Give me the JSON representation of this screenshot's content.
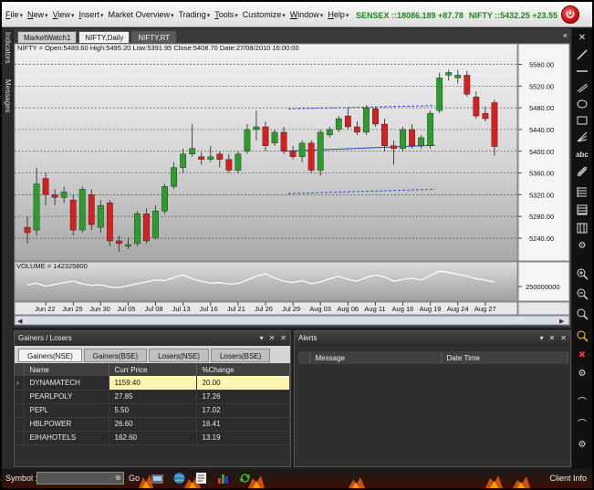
{
  "menu": [
    {
      "label": "File",
      "ul": "F",
      "rest": "ile",
      "caret": true
    },
    {
      "label": "New",
      "ul": "N",
      "rest": "ew",
      "caret": true
    },
    {
      "label": "View",
      "ul": "V",
      "rest": "iew",
      "caret": true
    },
    {
      "label": "Insert",
      "ul": "I",
      "rest": "nsert",
      "caret": true
    },
    {
      "label": "Market Overview",
      "ul": "",
      "rest": "Market Overview",
      "caret": true
    },
    {
      "label": "Trading",
      "ul": "",
      "rest": "Trading",
      "caret": true
    },
    {
      "label": "Tools",
      "ul": "T",
      "rest": "ools",
      "caret": true
    },
    {
      "label": "Customize",
      "ul": "",
      "rest": "Customize",
      "caret": true
    },
    {
      "label": "Window",
      "ul": "W",
      "rest": "indow",
      "caret": true
    },
    {
      "label": "Help",
      "ul": "H",
      "rest": "elp",
      "caret": true
    }
  ],
  "tickers": {
    "sensex": "SENSEX ::18086.189 +87.78",
    "nifty": "NIFTY ::5432.25 +23.55"
  },
  "left_tabs": [
    "Indicators",
    "Messages"
  ],
  "chart_tabs": [
    {
      "label": "MarketWatch1",
      "state": "normal"
    },
    {
      "label": "NIFTY,Daily",
      "state": "active"
    },
    {
      "label": "NIFTY,RT",
      "state": "dark"
    }
  ],
  "chart_close": "×",
  "chart_data": {
    "type": "candlestick",
    "header": "NIFTY = Open:5489.60 High:5495.20 Low:5391.95 Close:5408.70 Date:27/08/2010 16:00:00",
    "volume_label": "VOLUME = 142325800",
    "volume_tick": "250000000",
    "y_ticks": [
      5560.0,
      5520.0,
      5480.0,
      5440.0,
      5400.0,
      5360.0,
      5320.0,
      5280.0,
      5240.0
    ],
    "y_tick_labels": [
      "5560.00",
      "5520.00",
      "5480.00",
      "5440.00",
      "5400.00",
      "5360.00",
      "5320.00",
      "5280.00",
      "5240.00"
    ],
    "ylim": [
      5203,
      5576
    ],
    "x_labels": [
      "Jun 22",
      "Jun 25",
      "Jun 30",
      "Jul 05",
      "Jul 08",
      "Jul 13",
      "Jul 16",
      "Jul 21",
      "Jul 26",
      "Jul 29",
      "Aug 03",
      "Aug 06",
      "Aug 11",
      "Aug 16",
      "Aug 19",
      "Aug 24",
      "Aug 27"
    ],
    "x_label_index": [
      2,
      5,
      8,
      11,
      14,
      17,
      20,
      23,
      26,
      29,
      32,
      35,
      38,
      41,
      44,
      47,
      50
    ],
    "candles": [
      {
        "o": 5260,
        "h": 5280,
        "l": 5230,
        "c": 5250
      },
      {
        "o": 5255,
        "h": 5370,
        "l": 5245,
        "c": 5340
      },
      {
        "o": 5350,
        "h": 5360,
        "l": 5300,
        "c": 5320
      },
      {
        "o": 5320,
        "h": 5330,
        "l": 5300,
        "c": 5315
      },
      {
        "o": 5315,
        "h": 5335,
        "l": 5305,
        "c": 5325
      },
      {
        "o": 5310,
        "h": 5320,
        "l": 5245,
        "c": 5255
      },
      {
        "o": 5255,
        "h": 5335,
        "l": 5250,
        "c": 5330
      },
      {
        "o": 5320,
        "h": 5330,
        "l": 5255,
        "c": 5265
      },
      {
        "o": 5260,
        "h": 5310,
        "l": 5250,
        "c": 5300
      },
      {
        "o": 5305,
        "h": 5310,
        "l": 5225,
        "c": 5235
      },
      {
        "o": 5235,
        "h": 5245,
        "l": 5215,
        "c": 5230
      },
      {
        "o": 5225,
        "h": 5240,
        "l": 5220,
        "c": 5228
      },
      {
        "o": 5230,
        "h": 5290,
        "l": 5225,
        "c": 5285
      },
      {
        "o": 5285,
        "h": 5295,
        "l": 5230,
        "c": 5235
      },
      {
        "o": 5240,
        "h": 5300,
        "l": 5238,
        "c": 5290
      },
      {
        "o": 5290,
        "h": 5340,
        "l": 5285,
        "c": 5335
      },
      {
        "o": 5335,
        "h": 5380,
        "l": 5330,
        "c": 5370
      },
      {
        "o": 5370,
        "h": 5405,
        "l": 5360,
        "c": 5395
      },
      {
        "o": 5395,
        "h": 5450,
        "l": 5390,
        "c": 5405
      },
      {
        "o": 5390,
        "h": 5398,
        "l": 5375,
        "c": 5385
      },
      {
        "o": 5385,
        "h": 5410,
        "l": 5380,
        "c": 5390
      },
      {
        "o": 5395,
        "h": 5400,
        "l": 5370,
        "c": 5385
      },
      {
        "o": 5385,
        "h": 5395,
        "l": 5360,
        "c": 5365
      },
      {
        "o": 5365,
        "h": 5400,
        "l": 5360,
        "c": 5395
      },
      {
        "o": 5400,
        "h": 5450,
        "l": 5395,
        "c": 5440
      },
      {
        "o": 5440,
        "h": 5475,
        "l": 5420,
        "c": 5445
      },
      {
        "o": 5445,
        "h": 5455,
        "l": 5400,
        "c": 5410
      },
      {
        "o": 5415,
        "h": 5440,
        "l": 5410,
        "c": 5435
      },
      {
        "o": 5435,
        "h": 5445,
        "l": 5395,
        "c": 5400
      },
      {
        "o": 5400,
        "h": 5410,
        "l": 5385,
        "c": 5390
      },
      {
        "o": 5390,
        "h": 5420,
        "l": 5380,
        "c": 5415
      },
      {
        "o": 5415,
        "h": 5420,
        "l": 5360,
        "c": 5365
      },
      {
        "o": 5365,
        "h": 5440,
        "l": 5355,
        "c": 5435
      },
      {
        "o": 5430,
        "h": 5445,
        "l": 5425,
        "c": 5440
      },
      {
        "o": 5440,
        "h": 5465,
        "l": 5435,
        "c": 5460
      },
      {
        "o": 5465,
        "h": 5480,
        "l": 5440,
        "c": 5445
      },
      {
        "o": 5445,
        "h": 5455,
        "l": 5430,
        "c": 5435
      },
      {
        "o": 5435,
        "h": 5485,
        "l": 5430,
        "c": 5480
      },
      {
        "o": 5478,
        "h": 5482,
        "l": 5445,
        "c": 5450
      },
      {
        "o": 5450,
        "h": 5460,
        "l": 5400,
        "c": 5410
      },
      {
        "o": 5410,
        "h": 5420,
        "l": 5375,
        "c": 5405
      },
      {
        "o": 5405,
        "h": 5445,
        "l": 5400,
        "c": 5440
      },
      {
        "o": 5440,
        "h": 5450,
        "l": 5405,
        "c": 5410
      },
      {
        "o": 5410,
        "h": 5430,
        "l": 5405,
        "c": 5425
      },
      {
        "o": 5410,
        "h": 5475,
        "l": 5405,
        "c": 5470
      },
      {
        "o": 5475,
        "h": 5545,
        "l": 5470,
        "c": 5535
      },
      {
        "o": 5540,
        "h": 5550,
        "l": 5530,
        "c": 5545
      },
      {
        "o": 5535,
        "h": 5550,
        "l": 5525,
        "c": 5540
      },
      {
        "o": 5540,
        "h": 5548,
        "l": 5500,
        "c": 5505
      },
      {
        "o": 5500,
        "h": 5510,
        "l": 5460,
        "c": 5465
      },
      {
        "o": 5470,
        "h": 5482,
        "l": 5455,
        "c": 5460
      },
      {
        "o": 5489.6,
        "h": 5495.2,
        "l": 5391.95,
        "c": 5408.7
      }
    ],
    "trendlines": [
      {
        "x1": 28.5,
        "y1": 5478,
        "x2": 44.5,
        "y2": 5484,
        "style": "dashed"
      },
      {
        "x1": 28.0,
        "y1": 5400,
        "x2": 44.5,
        "y2": 5411,
        "style": "solid"
      },
      {
        "x1": 28.5,
        "y1": 5322,
        "x2": 44.5,
        "y2": 5330,
        "style": "dashed"
      }
    ],
    "volume": [
      120,
      135,
      110,
      125,
      140,
      150,
      130,
      118,
      122,
      105,
      100,
      115,
      130,
      145,
      160,
      155,
      180,
      200,
      170,
      150,
      135,
      140,
      128,
      132,
      160,
      190,
      210,
      175,
      150,
      140,
      155,
      130,
      145,
      170,
      190,
      165,
      150,
      180,
      200,
      185,
      150,
      165,
      175,
      160,
      195,
      230,
      220,
      205,
      190,
      170,
      160,
      142
    ]
  },
  "gainers_panel": {
    "title": "Gainers / Losers",
    "buttons": [
      "▾",
      "✕",
      "✕"
    ],
    "tabs": [
      {
        "label": "Gainers(NSE)",
        "active": true
      },
      {
        "label": "Gainers(BSE)",
        "active": false
      },
      {
        "label": "Losers(NSE)",
        "active": false
      },
      {
        "label": "Losers(BSE)",
        "active": false
      }
    ],
    "columns": [
      "Name",
      "Curr Price",
      "%Change"
    ],
    "rows": [
      {
        "marker": "›",
        "name": "DYNAMATECH",
        "price": "1159.40",
        "change": "20.00",
        "selected": true
      },
      {
        "marker": "",
        "name": "PEARLPOLY",
        "price": "27.85",
        "change": "17.26",
        "selected": false
      },
      {
        "marker": "",
        "name": "PEPL",
        "price": "5.50",
        "change": "17.02",
        "selected": false
      },
      {
        "marker": "",
        "name": "HBLPOWER",
        "price": "26.60",
        "change": "16.41",
        "selected": false
      },
      {
        "marker": "",
        "name": "EIHAHOTELS",
        "price": "162.60",
        "change": "13.19",
        "selected": false
      }
    ]
  },
  "alerts_panel": {
    "title": "Alerts",
    "buttons": [
      "▾",
      "✕",
      "✕"
    ],
    "columns": [
      "Message",
      "Date Time"
    ]
  },
  "statusbar": {
    "symbol_label": "Symbol :",
    "symbol_value": "",
    "go_label": "Go",
    "client_info": "Client Info"
  },
  "colors": {
    "up": "#2c9c2c",
    "down": "#d81e1e",
    "trend_dashed": "#3a4fd0",
    "trend_solid": "#2244cc"
  }
}
